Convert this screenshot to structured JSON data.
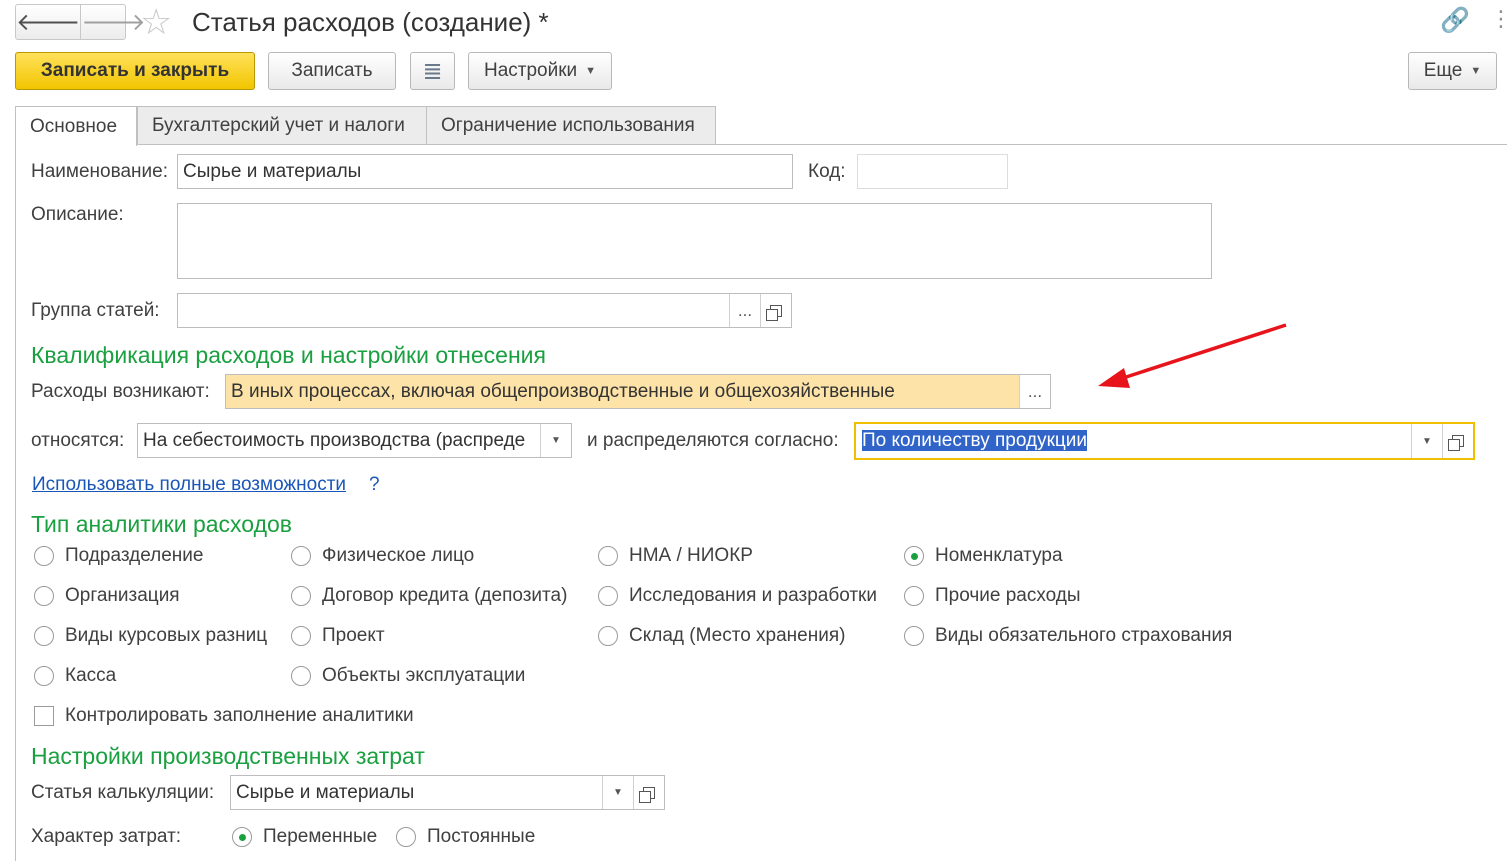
{
  "window": {
    "title": "Статья расходов (создание) *",
    "back_glyph": "🡐",
    "forward_glyph": "🡒",
    "star_glyph": "☆",
    "link_glyph": "🔗",
    "menu_glyph": "⋮"
  },
  "toolbar": {
    "save_close": "Записать и закрыть",
    "save": "Записать",
    "settings": "Настройки",
    "more": "Еще",
    "report_icon": "≣"
  },
  "tabs": [
    {
      "label": "Основное",
      "active": true
    },
    {
      "label": "Бухгалтерский учет и налоги",
      "active": false
    },
    {
      "label": "Ограничение использования",
      "active": false
    }
  ],
  "form": {
    "name_label": "Наименование:",
    "name_value": "Сырье и материалы",
    "code_label": "Код:",
    "code_value": "",
    "description_label": "Описание:",
    "description_value": "",
    "group_label": "Группа статей:",
    "group_value": "",
    "select_btn": "..."
  },
  "qualification": {
    "heading": "Квалификация расходов и настройки отнесения",
    "arise_label": "Расходы возникают:",
    "arise_value": "В иных процессах, включая общепроизводственные и общехозяйственные",
    "relate_label": "относятся:",
    "relate_value": "На себестоимость производства (распреде",
    "distribute_label": "и распределяются согласно:",
    "distribute_value": "По количеству продукции",
    "full_link": "Использовать полные возможности",
    "help": "?"
  },
  "analytics": {
    "heading": "Тип аналитики расходов",
    "options": [
      {
        "label": "Подразделение",
        "selected": false
      },
      {
        "label": "Организация",
        "selected": false
      },
      {
        "label": "Виды курсовых разниц",
        "selected": false
      },
      {
        "label": "Касса",
        "selected": false
      },
      {
        "label": "Физическое лицо",
        "selected": false
      },
      {
        "label": "Договор кредита (депозита)",
        "selected": false
      },
      {
        "label": "Проект",
        "selected": false
      },
      {
        "label": "Объекты эксплуатации",
        "selected": false
      },
      {
        "label": "НМА / НИОКР",
        "selected": false
      },
      {
        "label": "Исследования и разработки",
        "selected": false
      },
      {
        "label": "Склад (Место хранения)",
        "selected": false
      },
      {
        "label": "Номенклатура",
        "selected": true
      },
      {
        "label": "Прочие расходы",
        "selected": false
      },
      {
        "label": "Виды обязательного страхования",
        "selected": false
      }
    ],
    "control_label": "Контролировать заполнение аналитики",
    "control_checked": false
  },
  "production": {
    "heading": "Настройки производственных затрат",
    "calc_label": "Статья калькуляции:",
    "calc_value": "Сырье и материалы",
    "nature_label": "Характер затрат:",
    "variable_label": "Переменные",
    "variable_selected": true,
    "fixed_label": "Постоянные",
    "fixed_selected": false
  },
  "colors": {
    "accent_green": "#1aa040",
    "highlight_field": "#fde3a7",
    "focus_border": "#f0c000",
    "link": "#1a56b8",
    "arrow": "#e8141b"
  }
}
